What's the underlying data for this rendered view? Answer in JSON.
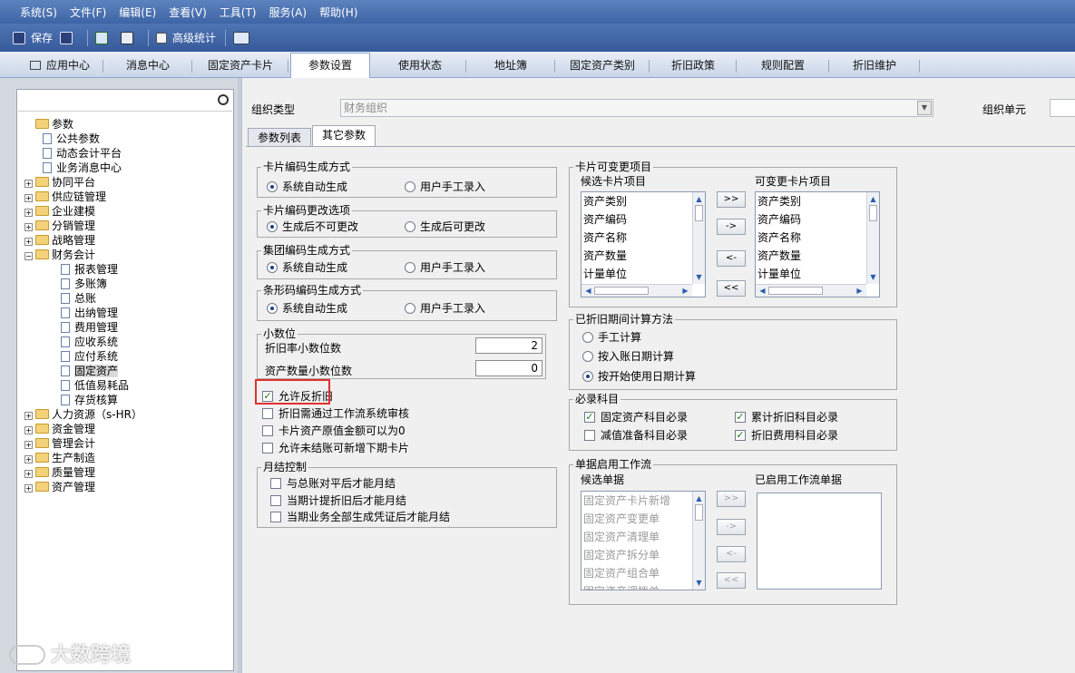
{
  "menubar": [
    "系统(S)",
    "文件(F)",
    "编辑(E)",
    "查看(V)",
    "工具(T)",
    "服务(A)",
    "帮助(H)"
  ],
  "toolbar": {
    "save": "保存",
    "advanced_stats": "高级统计"
  },
  "navtabs": [
    "应用中心",
    "消息中心",
    "固定资产卡片",
    "参数设置",
    "使用状态",
    "地址簿",
    "固定资产类别",
    "折旧政策",
    "规则配置",
    "折旧维护"
  ],
  "tree": {
    "root": "参数",
    "items": [
      "公共参数",
      "动态会计平台",
      "业务消息中心",
      "协同平台",
      "供应链管理",
      "企业建模",
      "分销管理",
      "战略管理",
      "财务会计",
      "报表管理",
      "多账簿",
      "总账",
      "出纳管理",
      "费用管理",
      "应收系统",
      "应付系统",
      "固定资产",
      "低值易耗品",
      "存货核算",
      "人力资源（s-HR）",
      "资金管理",
      "管理会计",
      "生产制造",
      "质量管理",
      "资产管理"
    ]
  },
  "form": {
    "org_type_label": "组织类型",
    "org_type_value": "财务组织",
    "org_unit_label": "组织单元",
    "subtabs": [
      "参数列表",
      "其它参数"
    ]
  },
  "card_code": {
    "title": "卡片编码生成方式",
    "opt1": "系统自动生成",
    "opt2": "用户手工录入"
  },
  "card_change": {
    "title": "卡片编码更改选项",
    "opt1": "生成后不可更改",
    "opt2": "生成后可更改"
  },
  "group_code": {
    "title": "集团编码生成方式",
    "opt1": "系统自动生成",
    "opt2": "用户手工录入"
  },
  "barcode": {
    "title": "条形码编码生成方式",
    "opt1": "系统自动生成",
    "opt2": "用户手工录入"
  },
  "decimals": {
    "title": "小数位",
    "rate_label": "折旧率小数位数",
    "rate_value": "2",
    "qty_label": "资产数量小数位数",
    "qty_value": "0"
  },
  "checks": [
    "允许反折旧",
    "折旧需通过工作流系统审核",
    "卡片资产原值金额可以为0",
    "允许未结账可新增下期卡片"
  ],
  "month_close": {
    "title": "月结控制",
    "items": [
      "与总账对平后才能月结",
      "当期计提折旧后才能月结",
      "当期业务全部生成凭证后才能月结"
    ]
  },
  "card_items": {
    "title": "卡片可变更项目",
    "left_label": "候选卡片项目",
    "right_label": "可变更卡片项目",
    "left": [
      "资产类别",
      "资产编码",
      "资产名称",
      "资产数量",
      "计量单位"
    ],
    "right": [
      "资产类别",
      "资产编码",
      "资产名称",
      "资产数量",
      "计量单位"
    ],
    "buttons": [
      ">>",
      "->",
      "<-",
      "<<"
    ]
  },
  "period_calc": {
    "title": "已折旧期间计算方法",
    "opt1": "手工计算",
    "opt2": "按入账日期计算",
    "opt3": "按开始使用日期计算"
  },
  "required": {
    "title": "必录科目",
    "items": [
      "固定资产科目必录",
      "累计折旧科目必录",
      "减值准备科目必录",
      "折旧费用科目必录"
    ]
  },
  "workflow": {
    "title": "单据启用工作流",
    "left_label": "候选单据",
    "right_label": "已启用工作流单据",
    "left": [
      "固定资产卡片新增",
      "固定资产变更单",
      "固定资产清理单",
      "固定资产拆分单",
      "固定资产组合单",
      "固定资产调拨单"
    ],
    "buttons": [
      ">>",
      "->",
      "<-",
      "<<"
    ]
  },
  "watermark": "大数跨境"
}
